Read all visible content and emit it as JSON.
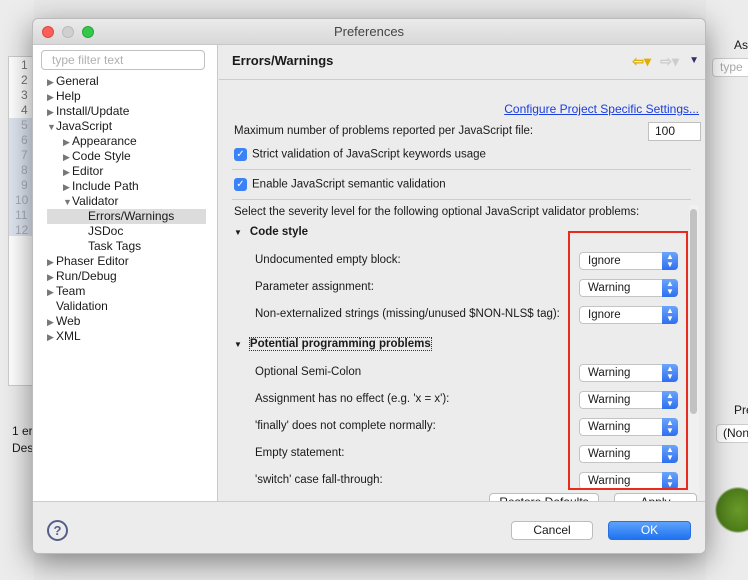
{
  "window": {
    "title": "Preferences"
  },
  "background": {
    "line_numbers": [
      "1",
      "2",
      "3",
      "4",
      "5",
      "6",
      "7",
      "8",
      "9",
      "10",
      "11",
      "12"
    ],
    "left_panel_texts": [
      "1 er",
      "Des"
    ],
    "right_panel_texts": [
      "Ass",
      "type",
      "Pre",
      "(Non"
    ]
  },
  "tree": {
    "filter_placeholder": "type filter text",
    "items": [
      {
        "label": "General",
        "level": 0,
        "arrow": "right"
      },
      {
        "label": "Help",
        "level": 0,
        "arrow": "right"
      },
      {
        "label": "Install/Update",
        "level": 0,
        "arrow": "right"
      },
      {
        "label": "JavaScript",
        "level": 0,
        "arrow": "down"
      },
      {
        "label": "Appearance",
        "level": 1,
        "arrow": "right"
      },
      {
        "label": "Code Style",
        "level": 1,
        "arrow": "right"
      },
      {
        "label": "Editor",
        "level": 1,
        "arrow": "right"
      },
      {
        "label": "Include Path",
        "level": 1,
        "arrow": "right"
      },
      {
        "label": "Validator",
        "level": 1,
        "arrow": "down"
      },
      {
        "label": "Errors/Warnings",
        "level": 2,
        "selected": true
      },
      {
        "label": "JSDoc",
        "level": 2
      },
      {
        "label": "Task Tags",
        "level": 2
      },
      {
        "label": "Phaser Editor",
        "level": 0,
        "arrow": "right"
      },
      {
        "label": "Run/Debug",
        "level": 0,
        "arrow": "right"
      },
      {
        "label": "Team",
        "level": 0,
        "arrow": "right"
      },
      {
        "label": "Validation",
        "level": 0
      },
      {
        "label": "Web",
        "level": 0,
        "arrow": "right"
      },
      {
        "label": "XML",
        "level": 0,
        "arrow": "right"
      }
    ]
  },
  "page": {
    "title": "Errors/Warnings",
    "configure_link": "Configure Project Specific Settings...",
    "max_problems_label": "Maximum number of problems reported per JavaScript file:",
    "max_problems_value": "100",
    "strict_validation": {
      "label": "Strict validation of JavaScript keywords usage",
      "checked": true
    },
    "semantic_validation": {
      "label": "Enable JavaScript semantic validation",
      "checked": true
    },
    "severity_intro": "Select the severity level for the following optional JavaScript validator problems:",
    "sections": [
      {
        "title": "Code style",
        "items": [
          {
            "label": "Undocumented empty block:",
            "value": "Ignore"
          },
          {
            "label": "Parameter assignment:",
            "value": "Warning"
          },
          {
            "label": "Non-externalized strings (missing/unused $NON-NLS$ tag):",
            "value": "Ignore"
          }
        ]
      },
      {
        "title": "Potential programming problems",
        "items": [
          {
            "label": "Optional Semi-Colon",
            "value": "Warning"
          },
          {
            "label": "Assignment has no effect (e.g. 'x = x'):",
            "value": "Warning"
          },
          {
            "label": "'finally' does not complete normally:",
            "value": "Warning"
          },
          {
            "label": "Empty statement:",
            "value": "Warning"
          },
          {
            "label": "'switch' case fall-through:",
            "value": "Warning"
          }
        ]
      }
    ],
    "restore_defaults": "Restore Defaults",
    "apply": "Apply"
  },
  "footer": {
    "cancel": "Cancel",
    "ok": "OK"
  },
  "colors": {
    "highlight": "#e82b1e",
    "accent": "#3b82f6",
    "link": "#1b3ee0"
  }
}
